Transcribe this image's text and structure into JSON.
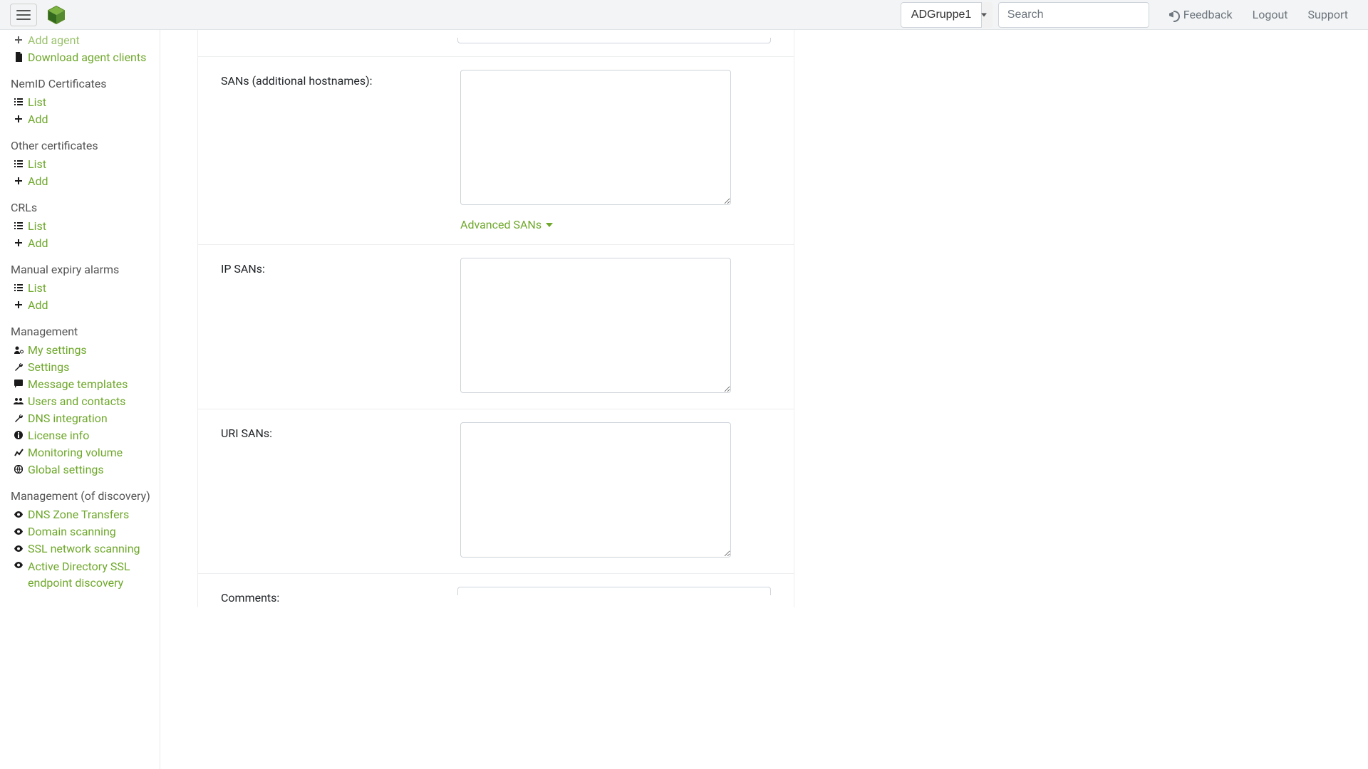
{
  "topbar": {
    "group_selected": "ADGruppe1",
    "search_placeholder": "Search",
    "feedback": "Feedback",
    "logout": "Logout",
    "support": "Support"
  },
  "sidebar": {
    "agents": {
      "add_agent": "Add agent",
      "download_clients": "Download agent clients"
    },
    "nemid": {
      "heading": "NemID Certificates",
      "list": "List",
      "add": "Add"
    },
    "other_certs": {
      "heading": "Other certificates",
      "list": "List",
      "add": "Add"
    },
    "crls": {
      "heading": "CRLs",
      "list": "List",
      "add": "Add"
    },
    "manual_alarms": {
      "heading": "Manual expiry alarms",
      "list": "List",
      "add": "Add"
    },
    "management": {
      "heading": "Management",
      "my_settings": "My settings",
      "settings": "Settings",
      "message_templates": "Message templates",
      "users_contacts": "Users and contacts",
      "dns_integration": "DNS integration",
      "license_info": "License info",
      "monitoring_volume": "Monitoring volume",
      "global_settings": "Global settings"
    },
    "discovery": {
      "heading": "Management (of discovery)",
      "dns_zone": "DNS Zone Transfers",
      "domain_scanning": "Domain scanning",
      "ssl_network": "SSL network scanning",
      "ad_ssl": "Active Directory SSL endpoint discovery"
    }
  },
  "form": {
    "sans_label": "SANs (additional hostnames):",
    "sans_value": "",
    "advanced_sans": "Advanced SANs",
    "ip_sans_label": "IP SANs:",
    "ip_sans_value": "",
    "uri_sans_label": "URI SANs:",
    "uri_sans_value": "",
    "comments_label": "Comments:",
    "comments_value": ""
  }
}
